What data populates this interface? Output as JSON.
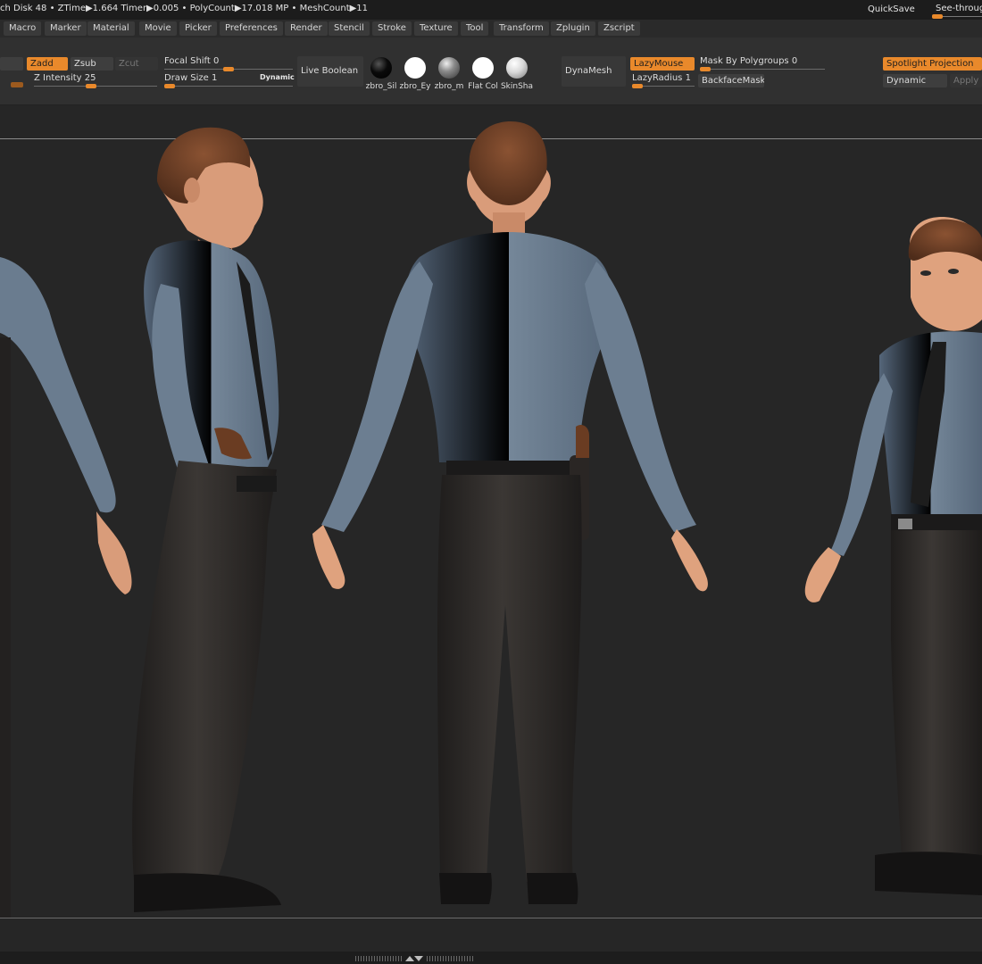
{
  "status_bar": {
    "text": "ch Disk 48  •  ZTime▶1.664 Timer▶0.005  •  PolyCount▶17.018 MP  •  MeshCount▶11",
    "quicksave": "QuickSave",
    "see_through": "See-through"
  },
  "menu": [
    "Macro",
    "Marker",
    "Material",
    "Movie",
    "Picker",
    "Preferences",
    "Render",
    "Stencil",
    "Stroke",
    "Texture",
    "Tool",
    "Transform",
    "Zplugin",
    "Zscript"
  ],
  "shelf": {
    "zadd": "Zadd",
    "zsub": "Zsub",
    "zcut": "Zcut",
    "focal_shift": "Focal Shift 0",
    "z_intensity": "Z Intensity 25",
    "draw_size": "Draw Size 1",
    "dynamic_badge": "Dynamic",
    "live_boolean": "Live Boolean",
    "materials": [
      {
        "label": "zbro_Sil",
        "icon": "black-sphere-icon"
      },
      {
        "label": "zbro_Ey",
        "icon": "white-sphere-icon"
      },
      {
        "label": "zbro_m",
        "icon": "grey-sphere-icon"
      },
      {
        "label": "Flat Col",
        "icon": "white-sphere-icon"
      },
      {
        "label": "SkinSha",
        "icon": "skin-sphere-icon"
      }
    ],
    "dynamesh": "DynaMesh",
    "lazy_mouse": "LazyMouse",
    "lazy_radius": "LazyRadius 1",
    "mask_by_polygroups": "Mask By Polygroups 0",
    "backface_mask": "BackfaceMask",
    "spotlight_projection": "Spotlight Projection",
    "dynamic": "Dynamic",
    "apply": "Apply"
  },
  "colors": {
    "accent": "#e9892b",
    "shirt": "#6d7f91",
    "pants": "#2b2826",
    "skin": "#e0a27f",
    "hair": "#6b3f26",
    "background": "#262626"
  }
}
